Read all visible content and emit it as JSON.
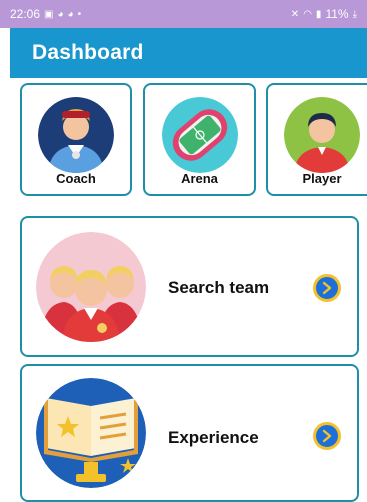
{
  "status_bar": {
    "time": "22:06",
    "left_icons": [
      "gallery-icon",
      "messenger-icon",
      "messenger-icon",
      "dot-icon"
    ],
    "battery": "11%",
    "right_icons": [
      "mute-icon",
      "wifi-icon",
      "signal-icon",
      "battery-icon",
      "download-icon"
    ]
  },
  "header": {
    "title": "Dashboard",
    "background": "#1a96cf"
  },
  "categories": [
    {
      "label": "Coach",
      "icon": "coach-avatar-icon"
    },
    {
      "label": "Arena",
      "icon": "stadium-icon"
    },
    {
      "label": "Player",
      "icon": "player-avatar-icon"
    }
  ],
  "actions": [
    {
      "label": "Search team",
      "icon": "team-players-icon"
    },
    {
      "label": "Experience",
      "icon": "book-trophy-icon"
    }
  ],
  "colors": {
    "card_border": "#1f8fa8",
    "arrow": "#1e6fd9",
    "arrow_ring": "#f3c22b"
  }
}
